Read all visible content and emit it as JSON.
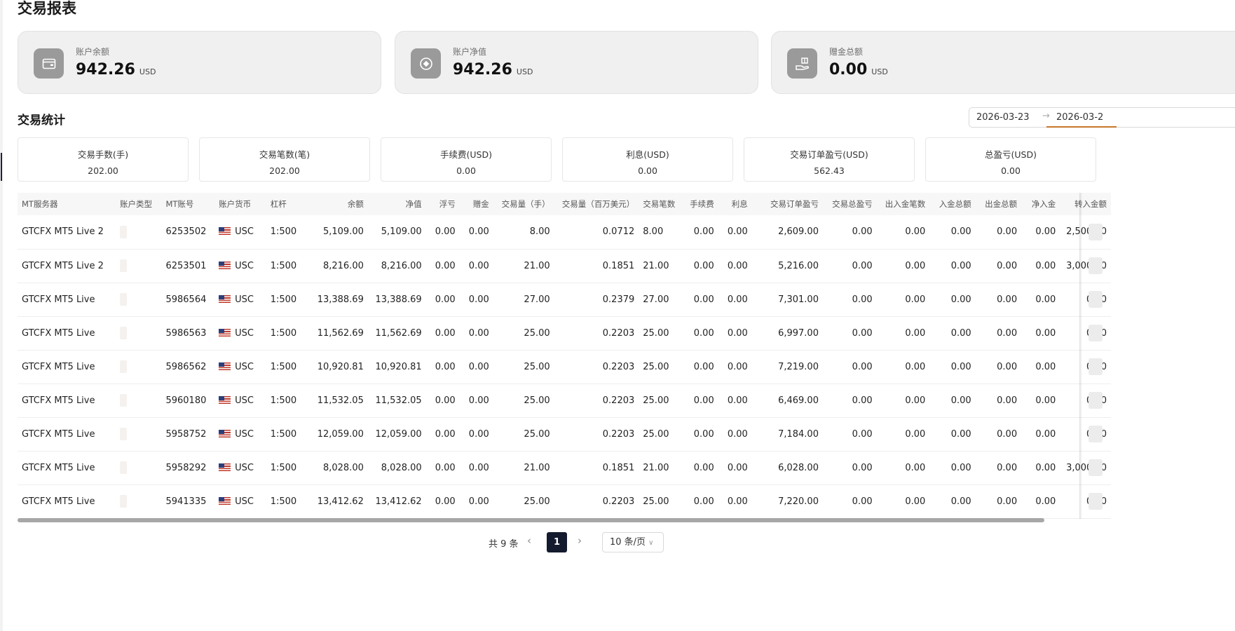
{
  "page": {
    "title": "交易报表"
  },
  "summary": [
    {
      "label": "账户余额",
      "value": "942.26",
      "unit": "USD",
      "icon": "wallet-icon"
    },
    {
      "label": "账户净值",
      "value": "942.26",
      "unit": "USD",
      "icon": "coin-icon"
    },
    {
      "label": "赠金总额",
      "value": "0.00",
      "unit": "USD",
      "icon": "gift-hand-icon"
    }
  ],
  "stats": {
    "title": "交易统计",
    "date_start": "2026-03-23",
    "date_end": "2026-03-2",
    "cards": [
      {
        "label": "交易手数(手)",
        "value": "202.00"
      },
      {
        "label": "交易笔数(笔)",
        "value": "202.00"
      },
      {
        "label": "手续费(USD)",
        "value": "0.00"
      },
      {
        "label": "利息(USD)",
        "value": "0.00"
      },
      {
        "label": "交易订单盈亏(USD)",
        "value": "562.43"
      },
      {
        "label": "总盈亏(USD)",
        "value": "0.00"
      }
    ]
  },
  "table": {
    "columns": [
      "MT服务器",
      "账户类型",
      "MT账号",
      "账户货币",
      "杠杆",
      "余额",
      "净值",
      "浮亏",
      "赠金",
      "交易量（手）",
      "交易量（百万美元）",
      "交易笔数",
      "手续费",
      "利息",
      "交易订单盈亏",
      "交易总盈亏",
      "出入金笔数",
      "入金总额",
      "出金总额",
      "净入金",
      "转入金额"
    ],
    "rows": [
      [
        "GTCFX MT5 Live 2",
        "",
        "6253502",
        "USC",
        "1:500",
        "5,109.00",
        "5,109.00",
        "0.00",
        "0.00",
        "8.00",
        "0.0712",
        "8.00",
        "0.00",
        "0.00",
        "2,609.00",
        "0.00",
        "0.00",
        "0.00",
        "0.00",
        "0.00",
        "2,500.00"
      ],
      [
        "GTCFX MT5 Live 2",
        "",
        "6253501",
        "USC",
        "1:500",
        "8,216.00",
        "8,216.00",
        "0.00",
        "0.00",
        "21.00",
        "0.1851",
        "21.00",
        "0.00",
        "0.00",
        "5,216.00",
        "0.00",
        "0.00",
        "0.00",
        "0.00",
        "0.00",
        "3,000.00"
      ],
      [
        "GTCFX MT5 Live",
        "",
        "5986564",
        "USC",
        "1:500",
        "13,388.69",
        "13,388.69",
        "0.00",
        "0.00",
        "27.00",
        "0.2379",
        "27.00",
        "0.00",
        "0.00",
        "7,301.00",
        "0.00",
        "0.00",
        "0.00",
        "0.00",
        "0.00",
        "0.00"
      ],
      [
        "GTCFX MT5 Live",
        "",
        "5986563",
        "USC",
        "1:500",
        "11,562.69",
        "11,562.69",
        "0.00",
        "0.00",
        "25.00",
        "0.2203",
        "25.00",
        "0.00",
        "0.00",
        "6,997.00",
        "0.00",
        "0.00",
        "0.00",
        "0.00",
        "0.00",
        "0.00"
      ],
      [
        "GTCFX MT5 Live",
        "",
        "5986562",
        "USC",
        "1:500",
        "10,920.81",
        "10,920.81",
        "0.00",
        "0.00",
        "25.00",
        "0.2203",
        "25.00",
        "0.00",
        "0.00",
        "7,219.00",
        "0.00",
        "0.00",
        "0.00",
        "0.00",
        "0.00",
        "0.00"
      ],
      [
        "GTCFX MT5 Live",
        "",
        "5960180",
        "USC",
        "1:500",
        "11,532.05",
        "11,532.05",
        "0.00",
        "0.00",
        "25.00",
        "0.2203",
        "25.00",
        "0.00",
        "0.00",
        "6,469.00",
        "0.00",
        "0.00",
        "0.00",
        "0.00",
        "0.00",
        "0.00"
      ],
      [
        "GTCFX MT5 Live",
        "",
        "5958752",
        "USC",
        "1:500",
        "12,059.00",
        "12,059.00",
        "0.00",
        "0.00",
        "25.00",
        "0.2203",
        "25.00",
        "0.00",
        "0.00",
        "7,184.00",
        "0.00",
        "0.00",
        "0.00",
        "0.00",
        "0.00",
        "0.00"
      ],
      [
        "GTCFX MT5 Live",
        "",
        "5958292",
        "USC",
        "1:500",
        "8,028.00",
        "8,028.00",
        "0.00",
        "0.00",
        "21.00",
        "0.1851",
        "21.00",
        "0.00",
        "0.00",
        "6,028.00",
        "0.00",
        "0.00",
        "0.00",
        "0.00",
        "0.00",
        "3,000.00"
      ],
      [
        "GTCFX MT5 Live",
        "",
        "5941335",
        "USC",
        "1:500",
        "13,412.62",
        "13,412.62",
        "0.00",
        "0.00",
        "25.00",
        "0.2203",
        "25.00",
        "0.00",
        "0.00",
        "7,220.00",
        "0.00",
        "0.00",
        "0.00",
        "0.00",
        "0.00",
        "0.00"
      ]
    ]
  },
  "pagination": {
    "total_text": "共 9 条",
    "prev_icon": "chevron-left-icon",
    "current_page": "1",
    "next_icon": "chevron-right-icon",
    "page_size": "10 条/页"
  }
}
